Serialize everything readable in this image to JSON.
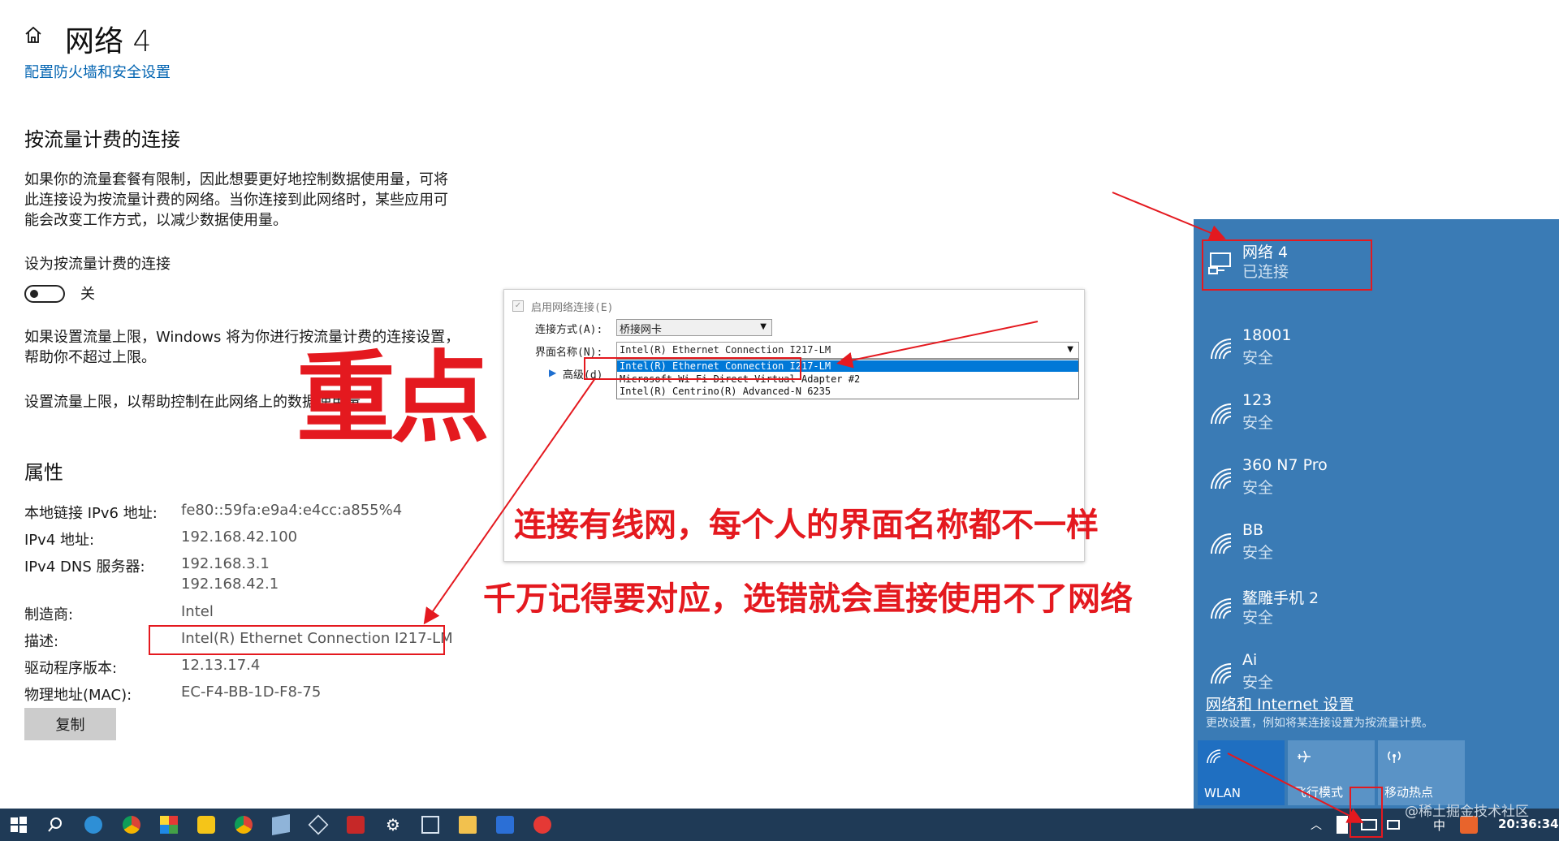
{
  "settings": {
    "title": "网络 4",
    "firewall_link": "配置防火墙和安全设置",
    "metered": {
      "heading": "按流量计费的连接",
      "desc_lines": [
        "如果你的流量套餐有限制，因此想要更好地控制数据使用量，可将",
        "此连接设为按流量计费的网络。当你连接到此网络时，某些应用可",
        "能会改变工作方式，以减少数据使用量。"
      ],
      "toggle_label": "设为按流量计费的连接",
      "toggle_state": "关",
      "limit_lines": [
        "如果设置流量上限，Windows 将为你进行按流量计费的连接设置，",
        "帮助你不超过上限。"
      ],
      "limit_link": "设置流量上限，以帮助控制在此网络上的数据使用量"
    },
    "properties": {
      "heading": "属性",
      "rows": [
        {
          "label": "本地链接 IPv6 地址:",
          "value": "fe80::59fa:e9a4:e4cc:a855%4"
        },
        {
          "label": "IPv4 地址:",
          "value": "192.168.42.100"
        },
        {
          "label": "IPv4 DNS 服务器:",
          "value": "192.168.3.1"
        },
        {
          "label": "",
          "value": "192.168.42.1"
        },
        {
          "label": "制造商:",
          "value": "Intel"
        },
        {
          "label": "描述:",
          "value": "Intel(R) Ethernet Connection I217-LM"
        },
        {
          "label": "驱动程序版本:",
          "value": "12.13.17.4"
        },
        {
          "label": "物理地址(MAC):",
          "value": "EC-F4-BB-1D-F8-75"
        }
      ],
      "copy_button": "复制"
    }
  },
  "dialog": {
    "enable_label": "启用网络连接(E)",
    "mode_label": "连接方式(A):",
    "mode_value": "桥接网卡",
    "iface_label": "界面名称(N):",
    "iface_value": "Intel(R) Ethernet Connection I217-LM",
    "advanced_label": "高级(d)",
    "options": [
      "Intel(R) Ethernet Connection I217-LM",
      "Microsoft Wi-Fi Direct Virtual Adapter #2",
      "Intel(R) Centrino(R) Advanced-N 6235"
    ]
  },
  "annotations": {
    "big": "重点",
    "line1": "连接有线网，每个人的界面名称都不一样",
    "line2": "千万记得要对应，选错就会直接使用不了网络",
    "color": "#e4191f"
  },
  "flyout": {
    "connected": {
      "name": "网络 4",
      "status": "已连接"
    },
    "networks": [
      {
        "name": "18001",
        "status": "安全"
      },
      {
        "name": "123",
        "status": "安全"
      },
      {
        "name": "360 N7 Pro",
        "status": "安全"
      },
      {
        "name": "BB",
        "status": "安全"
      },
      {
        "name": "鳌雕手机 2",
        "status": "安全"
      },
      {
        "name": "Ai",
        "status": "安全"
      }
    ],
    "settings_link": "网络和 Internet 设置",
    "settings_desc": "更改设置，例如将某连接设置为按流量计费。",
    "quick_actions": [
      {
        "label": "WLAN",
        "icon": "wifi-icon"
      },
      {
        "label": "飞行模式",
        "icon": "airplane-icon"
      },
      {
        "label": "移动热点",
        "icon": "hotspot-icon"
      }
    ],
    "bg_color": "#3a7bb5",
    "tile_active": "#1f6fc1"
  },
  "taskbar": {
    "input_method": "中",
    "clock": "20:36:34"
  },
  "watermark": "@稀土掘金技术社区"
}
